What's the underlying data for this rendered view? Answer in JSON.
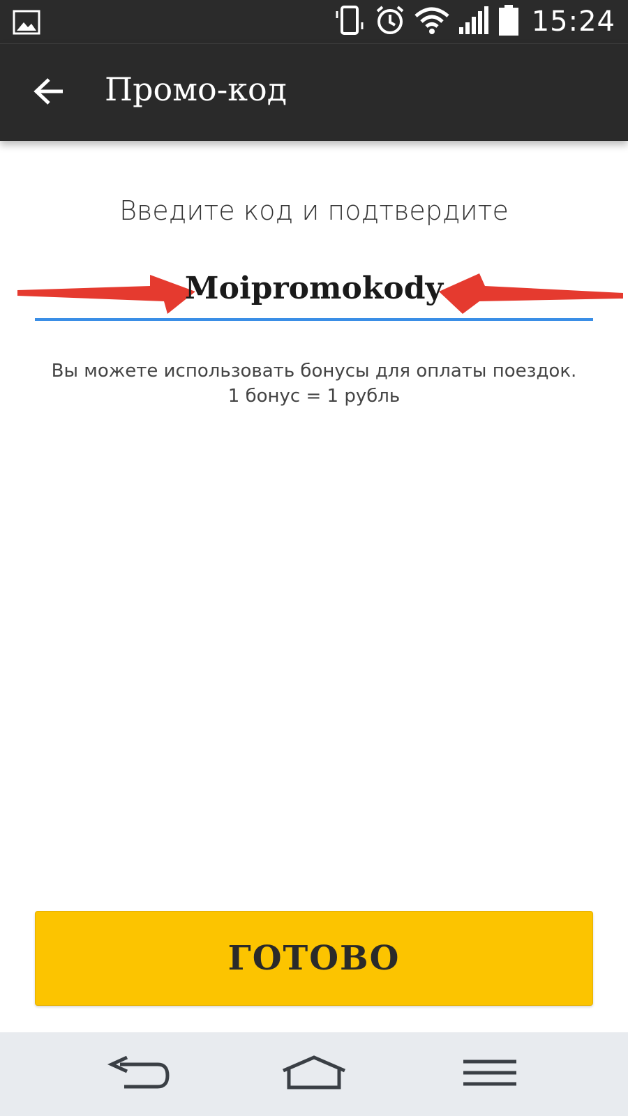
{
  "status_bar": {
    "time": "15:24",
    "icons": [
      "gallery-icon",
      "vibrate-icon",
      "alarm-icon",
      "wifi-icon",
      "signal-icon",
      "battery-icon"
    ]
  },
  "toolbar": {
    "title": "Промо-код",
    "back_icon": "arrow-left-icon"
  },
  "content": {
    "prompt": "Введите код и подтвердите",
    "promo_code_value": "Moipromokody",
    "info_line1": "Вы можете использовать бонусы для оплаты поездок.",
    "info_line2": "1 бонус = 1 рубль"
  },
  "done_button": {
    "label": "ГОТОВО"
  },
  "nav_bar": {
    "icons": [
      "back-nav-icon",
      "home-nav-icon",
      "menu-nav-icon"
    ]
  },
  "colors": {
    "toolbar_bg": "#2a2a2a",
    "accent_underline": "#3a8ee6",
    "button_yellow": "#fcc400",
    "annotation_arrow": "#e53a2f",
    "nav_bg": "#e8ebef"
  }
}
